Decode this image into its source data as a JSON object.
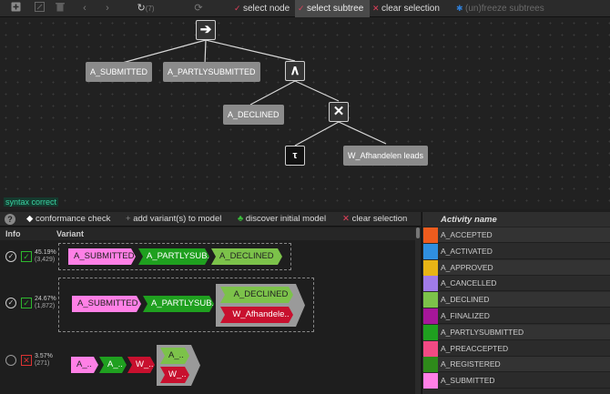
{
  "toolbar": {
    "undo_count": "(7)",
    "select_node": "select node",
    "select_subtree": "select subtree",
    "clear_selection": "clear selection",
    "freeze_subtrees": "(un)freeze subtrees",
    "colors": {
      "select_node_mark": "#e0405a",
      "clear_mark": "#e0405a",
      "freeze_mark": "#2f7fd8"
    }
  },
  "tree": {
    "root_operator": "sequence-arrow-icon",
    "root_symbol": "➔",
    "and_symbol": "∧",
    "xor_symbol": "✕",
    "tau_symbol": "τ",
    "leaves": {
      "a_submitted": "A_SUBMITTED",
      "a_partlysubmitted": "A_PARTLYSUBMITTED",
      "a_declined": "A_DECLINED",
      "w_afhandelen": "W_Afhandelen leads"
    },
    "syntax_status": "syntax correct"
  },
  "conformance_bar": {
    "help": "?",
    "conformance_check": "conformance check",
    "add_variants": "add variant(s) to model",
    "discover_initial": "discover initial model",
    "clear_selection": "clear selection"
  },
  "variants": {
    "header_info": "Info",
    "header_variant": "Variant",
    "rows": [
      {
        "pct": "45.19%",
        "count": "(3,429)",
        "fits": true,
        "activities": [
          "A_SUBMITTED",
          "A_PARTLYSUB..",
          "A_DECLINED"
        ]
      },
      {
        "pct": "24.67%",
        "count": "(1,872)",
        "fits": true,
        "activities": [
          "A_SUBMITTED",
          "A_PARTLYSUB..",
          "A_DECLINED",
          "W_Afhandele.."
        ]
      },
      {
        "pct": "3.57%",
        "count": "(271)",
        "fits": false,
        "activities": [
          "A_..",
          "A_..",
          "W_..",
          "A_..",
          "W_.."
        ]
      }
    ]
  },
  "activities": {
    "header": "Activity name",
    "items": [
      {
        "name": "A_ACCEPTED",
        "color": "#ee5c1e"
      },
      {
        "name": "A_ACTIVATED",
        "color": "#2f8fe0"
      },
      {
        "name": "A_APPROVED",
        "color": "#e8b416"
      },
      {
        "name": "A_CANCELLED",
        "color": "#a07be8"
      },
      {
        "name": "A_DECLINED",
        "color": "#7cc24a"
      },
      {
        "name": "A_FINALIZED",
        "color": "#a6169a"
      },
      {
        "name": "A_PARTLYSUBMITTED",
        "color": "#1fa01f"
      },
      {
        "name": "A_PREACCEPTED",
        "color": "#f24a84"
      },
      {
        "name": "A_REGISTERED",
        "color": "#2e8a1a"
      },
      {
        "name": "A_SUBMITTED",
        "color": "#ff80e6"
      }
    ]
  }
}
